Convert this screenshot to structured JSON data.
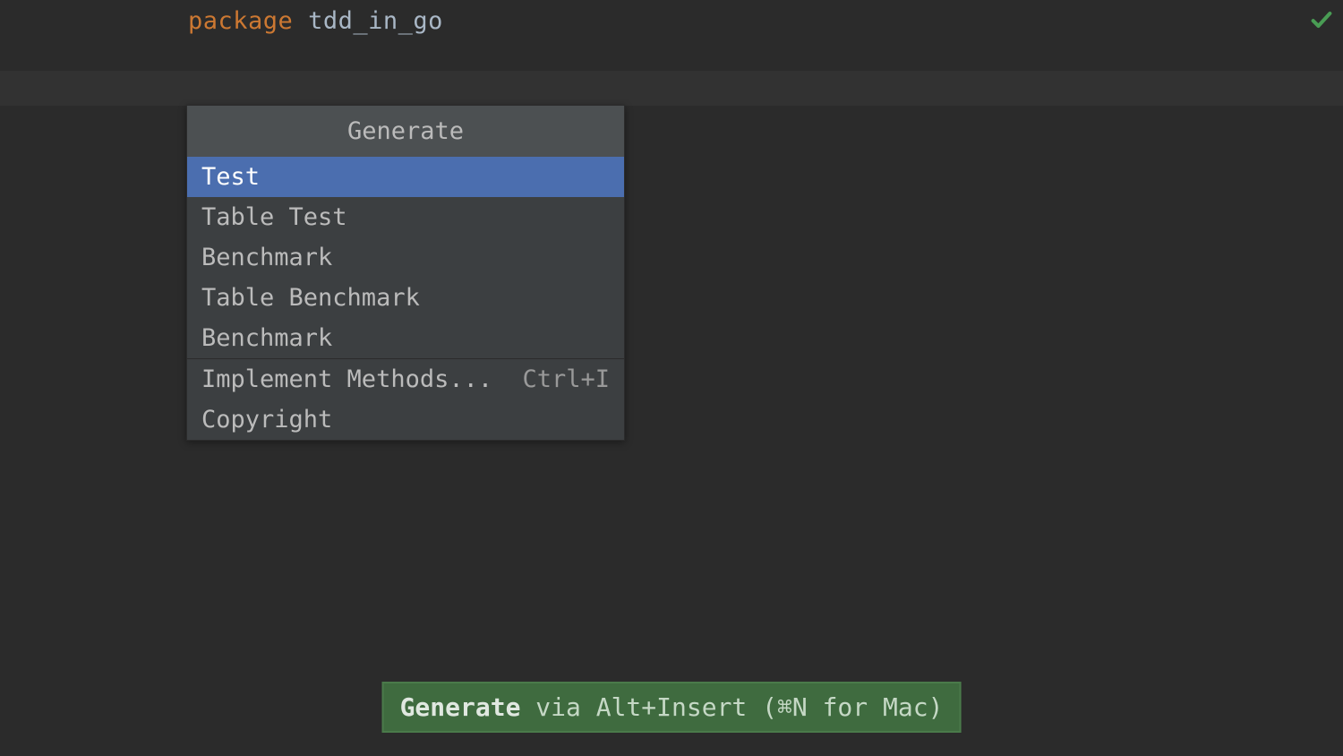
{
  "code": {
    "keyword": "package",
    "identifier": "tdd_in_go"
  },
  "popup": {
    "title": "Generate",
    "items": [
      {
        "label": "Test",
        "shortcut": "",
        "selected": true
      },
      {
        "label": "Table Test",
        "shortcut": "",
        "selected": false
      },
      {
        "label": "Benchmark",
        "shortcut": "",
        "selected": false
      },
      {
        "label": "Table Benchmark",
        "shortcut": "",
        "selected": false
      },
      {
        "label": "Benchmark",
        "shortcut": "",
        "selected": false
      }
    ],
    "items2": [
      {
        "label": "Implement Methods...",
        "shortcut": "Ctrl+I",
        "selected": false
      },
      {
        "label": "Copyright",
        "shortcut": "",
        "selected": false
      }
    ]
  },
  "hint": {
    "bold": "Generate",
    "rest": " via Alt+Insert (⌘N for Mac)"
  }
}
